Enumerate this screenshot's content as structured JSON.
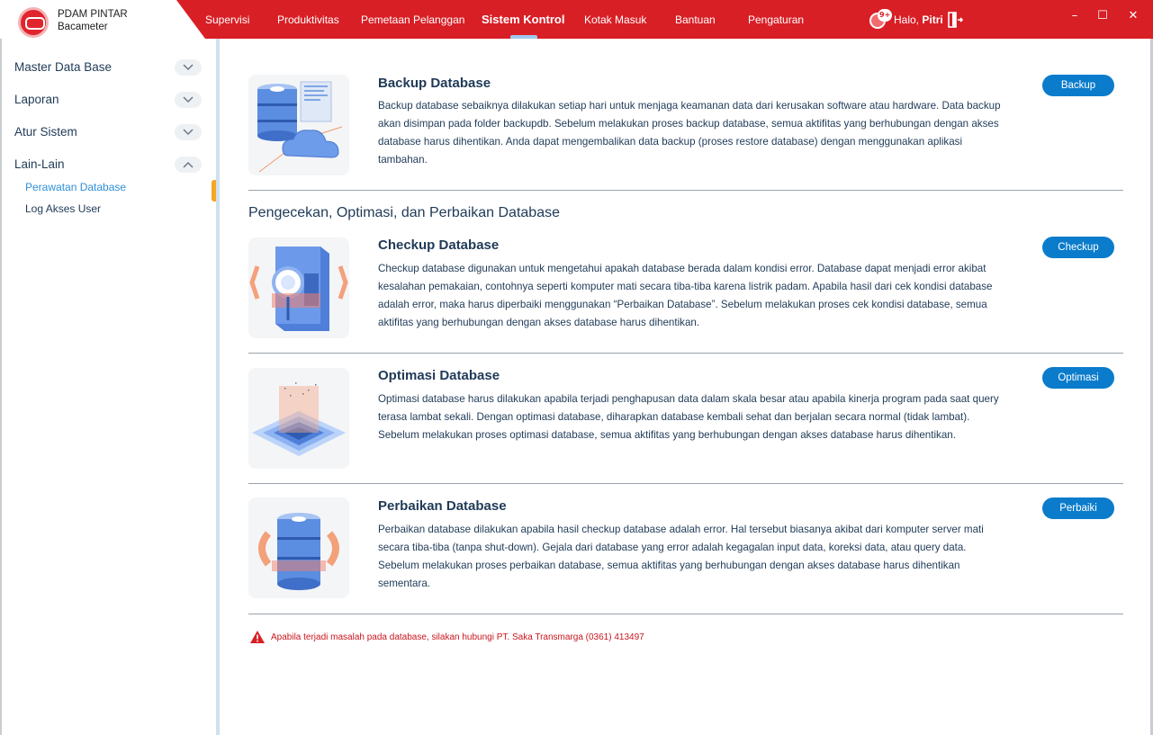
{
  "app": {
    "brand_title": "PDAM PINTAR",
    "brand_subtitle": "Bacameter",
    "nav": [
      {
        "label": "Supervisi"
      },
      {
        "label": "Produktivitas"
      },
      {
        "label": "Pemetaan Pelanggan"
      },
      {
        "label": "Sistem Kontrol",
        "active": true
      },
      {
        "label": "Kotak Masuk"
      },
      {
        "label": "Bantuan"
      },
      {
        "label": "Pengaturan"
      }
    ],
    "notification_badge": "9+",
    "greeting_prefix": "Halo,",
    "user_name": "Pitri",
    "window_controls": {
      "minimize": "–",
      "maximize": "☐",
      "close": "✕"
    }
  },
  "sidebar": {
    "groups": [
      {
        "label": "Master Data Base",
        "expanded": false
      },
      {
        "label": "Laporan",
        "expanded": false
      },
      {
        "label": "Atur Sistem",
        "expanded": false
      },
      {
        "label": "Lain-Lain",
        "expanded": true
      }
    ],
    "subitems": [
      {
        "label": "Perawatan Database",
        "active": true
      },
      {
        "label": "Log Akses User",
        "active": false
      }
    ]
  },
  "main": {
    "backup": {
      "title": "Backup Database",
      "description": "Backup database sebaiknya dilakukan setiap hari untuk menjaga keamanan data dari kerusakan software atau hardware. Data backup akan disimpan pada folder backupdb. Sebelum melakukan proses backup database, semua aktifitas yang berhubungan dengan akses database harus dihentikan. Anda dapat mengembalikan data backup (proses restore database) dengan menggunakan aplikasi tambahan.",
      "button": "Backup"
    },
    "section_title": "Pengecekan, Optimasi, dan Perbaikan Database",
    "checkup": {
      "title": "Checkup Database",
      "description": "Checkup database digunakan untuk mengetahui apakah database berada dalam kondisi error. Database dapat menjadi error akibat kesalahan pemakaian, contohnya seperti komputer mati secara tiba-tiba karena listrik padam. Apabila hasil dari cek kondisi database adalah error, maka harus diperbaiki menggunakan “Perbaikan Database”. Sebelum melakukan proses cek kondisi database, semua aktifitas yang berhubungan dengan akses database harus dihentikan.",
      "button": "Checkup"
    },
    "optimasi": {
      "title": "Optimasi Database",
      "description": "Optimasi database harus dilakukan apabila terjadi penghapusan data dalam skala besar atau apabila kinerja program pada saat query terasa lambat sekali. Dengan optimasi database, diharapkan database kembali sehat dan berjalan secara normal (tidak lambat). Sebelum melakukan proses optimasi database, semua aktifitas yang berhubungan dengan akses database harus dihentikan.",
      "button": "Optimasi"
    },
    "perbaikan": {
      "title": "Perbaikan Database",
      "description": "Perbaikan database dilakukan apabila hasil checkup database adalah error. Hal tersebut biasanya akibat dari komputer server mati secara tiba-tiba (tanpa shut-down). Gejala dari database yang error adalah kegagalan input data, koreksi data, atau query data. Sebelum melakukan proses perbaikan database, semua aktifitas yang berhubungan dengan akses database harus dihentikan sementara.",
      "button": "Perbaiki"
    },
    "warning": "Apabila terjadi masalah pada database, silakan hubungi PT. Saka Transmarga (0361) 413497"
  },
  "colors": {
    "brand_red": "#d81f26",
    "accent_blue": "#0b7ccb",
    "active_link": "#2f8fd8",
    "active_marker": "#f5a623",
    "warning_red": "#c8161d"
  },
  "icons": {
    "logo": "brand-logo-icon",
    "bell": "bell-icon",
    "logout": "logout-icon",
    "chevron_down": "chevron-down-icon",
    "chevron_up": "chevron-up-icon",
    "warning": "warning-triangle-icon"
  }
}
